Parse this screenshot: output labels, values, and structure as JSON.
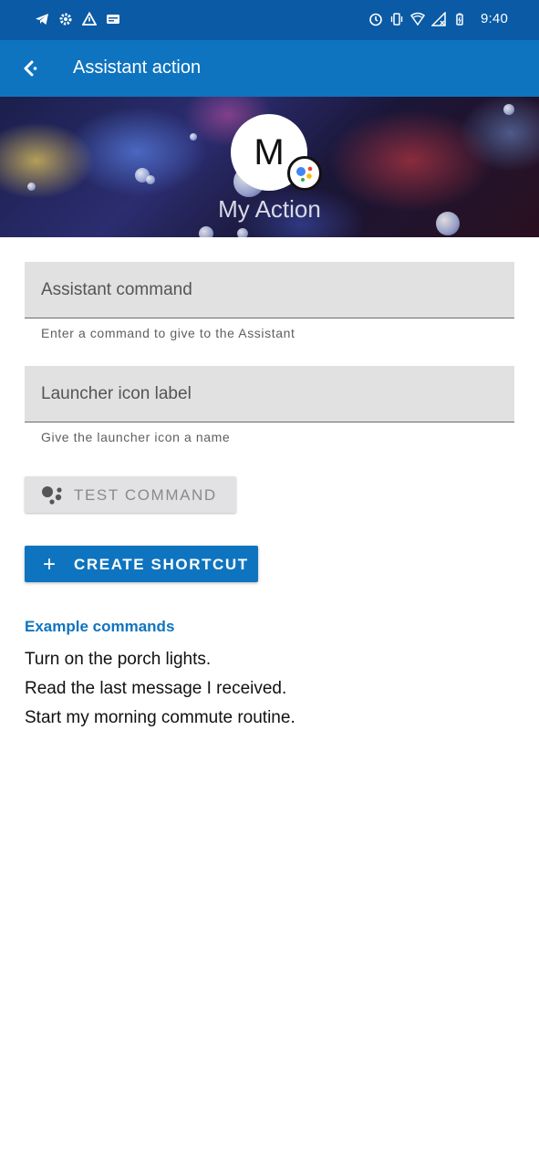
{
  "status_bar": {
    "time": "9:40",
    "left_icons": [
      "telegram-icon",
      "settings-icon",
      "warning-icon",
      "card-icon"
    ],
    "right_icons": [
      "timer-icon",
      "vibrate-icon",
      "wifi-icon",
      "signal-off-icon",
      "battery-icon"
    ]
  },
  "app_bar": {
    "title": "Assistant action"
  },
  "header": {
    "avatar_letter": "M",
    "action_name": "My Action"
  },
  "form": {
    "command_field": {
      "label": "Assistant command",
      "helper": "Enter a command to give to the Assistant"
    },
    "label_field": {
      "label": "Launcher icon label",
      "helper": "Give the launcher icon a name"
    }
  },
  "buttons": {
    "test_label": "TEST COMMAND",
    "create_label": "CREATE SHORTCUT",
    "create_icon": "+"
  },
  "examples": {
    "title": "Example commands",
    "items": [
      "Turn on the porch lights.",
      "Read the last message I received.",
      "Start my morning commute routine."
    ]
  },
  "colors": {
    "status_bar": "#0a5aa6",
    "app_bar": "#0f74bf",
    "accent": "#0f74bf",
    "field_bg": "#e1e1e1"
  }
}
